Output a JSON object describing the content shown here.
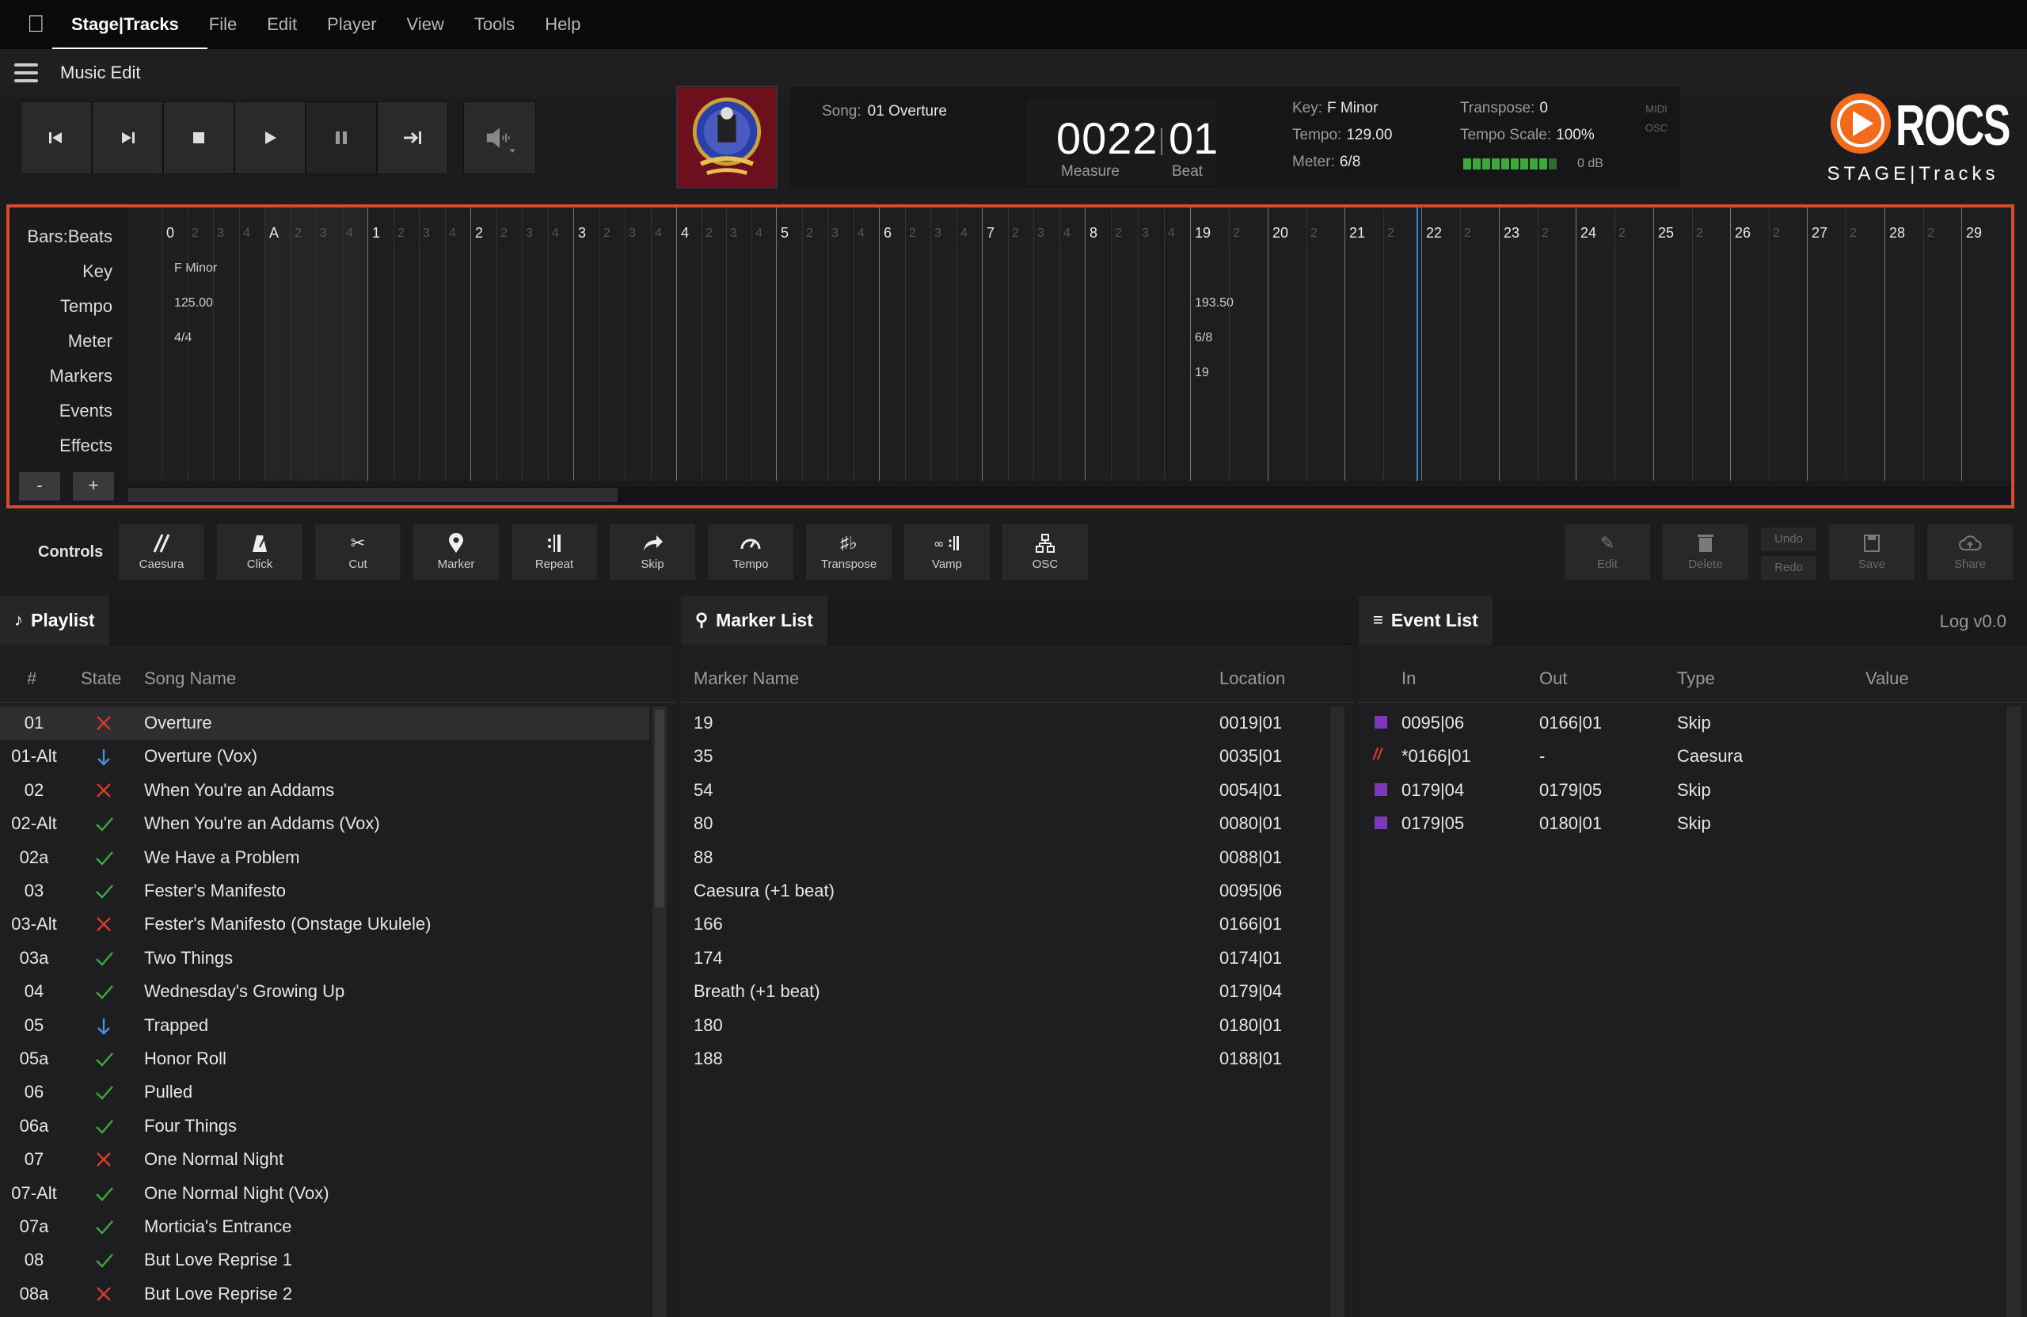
{
  "menubar": {
    "app": "Stage|Tracks",
    "items": [
      "File",
      "Edit",
      "Player",
      "View",
      "Tools",
      "Help"
    ]
  },
  "title": "Music Edit",
  "song": {
    "label": "Song:",
    "value": "01 Overture"
  },
  "counter": {
    "measure": "0022",
    "beat": "01",
    "measure_label": "Measure",
    "beat_label": "Beat"
  },
  "info": {
    "key_label": "Key:",
    "key": "F Minor",
    "tempo_label": "Tempo:",
    "tempo": "129.00",
    "meter_label": "Meter:",
    "meter": "6/8",
    "transpose_label": "Transpose:",
    "transpose": "0",
    "tscale_label": "Tempo Scale:",
    "tscale": "100%",
    "db": "0 dB",
    "level": 0.9,
    "midi": "MIDI",
    "osc": "OSC"
  },
  "logo": {
    "brand": "ROCS",
    "sub": "STAGE|Tracks"
  },
  "timeline": {
    "labels": [
      "Bars:Beats",
      "Key",
      "Tempo",
      "Meter",
      "Markers",
      "Events",
      "Effects"
    ],
    "minus": "-",
    "plus": "+",
    "key_start": "F Minor",
    "tempo_start": "125.00",
    "meter_start": "4/4",
    "tempo_19": "193.50",
    "meter_19": "6/8",
    "marker_19": "19"
  },
  "controls": {
    "label": "Controls",
    "buttons": [
      "Caesura",
      "Click",
      "Cut",
      "Marker",
      "Repeat",
      "Skip",
      "Tempo",
      "Transpose",
      "Vamp",
      "OSC"
    ],
    "right": [
      "Edit",
      "Delete",
      "Undo",
      "Redo",
      "Save",
      "Share"
    ]
  },
  "playlist": {
    "title": "Playlist",
    "cols": [
      "#",
      "State",
      "Song Name"
    ],
    "rows": [
      {
        "n": "01",
        "s": "x",
        "name": "Overture"
      },
      {
        "n": "01-Alt",
        "s": "down",
        "name": "Overture (Vox)"
      },
      {
        "n": "02",
        "s": "x",
        "name": "When You're an Addams"
      },
      {
        "n": "02-Alt",
        "s": "ok",
        "name": "When You're an Addams (Vox)"
      },
      {
        "n": "02a",
        "s": "ok",
        "name": "We Have a Problem"
      },
      {
        "n": "03",
        "s": "ok",
        "name": "Fester's Manifesto"
      },
      {
        "n": "03-Alt",
        "s": "x",
        "name": "Fester's Manifesto (Onstage Ukulele)"
      },
      {
        "n": "03a",
        "s": "ok",
        "name": "Two Things"
      },
      {
        "n": "04",
        "s": "ok",
        "name": "Wednesday's Growing Up"
      },
      {
        "n": "05",
        "s": "down",
        "name": "Trapped"
      },
      {
        "n": "05a",
        "s": "ok",
        "name": "Honor Roll"
      },
      {
        "n": "06",
        "s": "ok",
        "name": "Pulled"
      },
      {
        "n": "06a",
        "s": "ok",
        "name": "Four Things"
      },
      {
        "n": "07",
        "s": "x",
        "name": "One Normal Night"
      },
      {
        "n": "07-Alt",
        "s": "ok",
        "name": "One Normal Night (Vox)"
      },
      {
        "n": "07a",
        "s": "ok",
        "name": "Morticia's Entrance"
      },
      {
        "n": "08",
        "s": "ok",
        "name": "But Love Reprise 1"
      },
      {
        "n": "08a",
        "s": "x",
        "name": "But Love Reprise 2"
      }
    ]
  },
  "markers": {
    "title": "Marker List",
    "cols": [
      "Marker Name",
      "Location"
    ],
    "rows": [
      {
        "name": "19",
        "loc": "0019|01"
      },
      {
        "name": "35",
        "loc": "0035|01"
      },
      {
        "name": "54",
        "loc": "0054|01"
      },
      {
        "name": "80",
        "loc": "0080|01"
      },
      {
        "name": "88",
        "loc": "0088|01"
      },
      {
        "name": "Caesura (+1 beat)",
        "loc": "0095|06"
      },
      {
        "name": "166",
        "loc": "0166|01"
      },
      {
        "name": "174",
        "loc": "0174|01"
      },
      {
        "name": "Breath (+1 beat)",
        "loc": "0179|04"
      },
      {
        "name": "180",
        "loc": "0180|01"
      },
      {
        "name": "188",
        "loc": "0188|01"
      }
    ]
  },
  "events": {
    "title": "Event List",
    "log": "Log v0.0",
    "cols": [
      "In",
      "Out",
      "Type",
      "Value"
    ],
    "rows": [
      {
        "icon": "skip",
        "in": "0095|06",
        "out": "0166|01",
        "type": "Skip",
        "value": ""
      },
      {
        "icon": "caesura",
        "in": "*0166|01",
        "out": "-",
        "type": "Caesura",
        "value": ""
      },
      {
        "icon": "skip",
        "in": "0179|04",
        "out": "0179|05",
        "type": "Skip",
        "value": ""
      },
      {
        "icon": "skip",
        "in": "0179|05",
        "out": "0180|01",
        "type": "Skip",
        "value": ""
      }
    ]
  },
  "colors": {
    "accent": "#d84a2c",
    "ok": "#3ea83e",
    "x": "#d83a32",
    "down": "#4a90d9",
    "skip": "#7a3ab8"
  }
}
